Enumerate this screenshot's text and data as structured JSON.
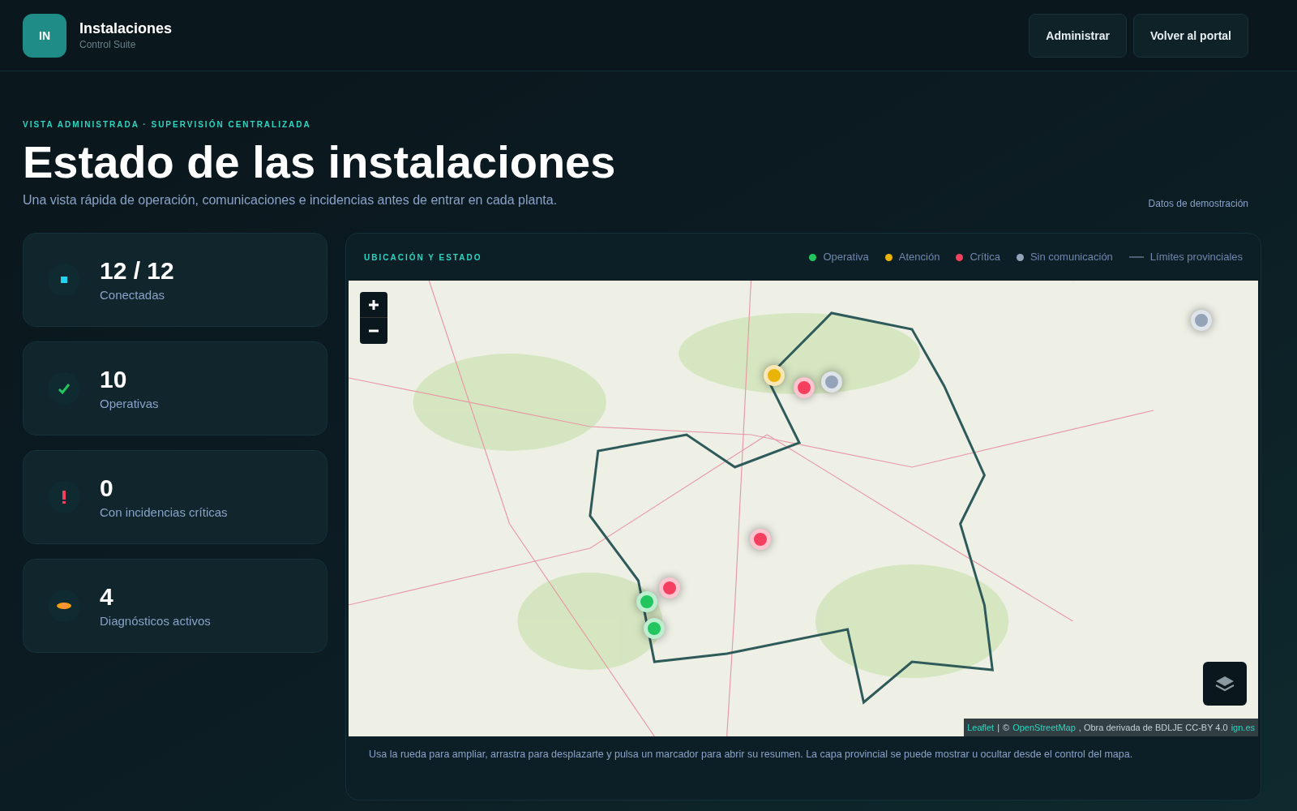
{
  "brand": {
    "logo": "IN",
    "title": "Instalaciones",
    "subtitle": "Control Suite"
  },
  "header_buttons": [
    "Administrar",
    "Volver al portal"
  ],
  "eyebrow": "VISTA ADMINISTRADA · SUPERVISIÓN CENTRALIZADA",
  "title": "Estado de las instalaciones",
  "subtitle": "Una vista rápida de operación, comunicaciones e incidencias antes de entrar en cada planta.",
  "demo_note": "Datos de demostración",
  "stats": [
    {
      "kind": "connected",
      "value": "12 / 12",
      "label": "Conectadas"
    },
    {
      "kind": "ok",
      "value": "10",
      "label": "Operativas"
    },
    {
      "kind": "critical",
      "value": "0",
      "label": "Con incidencias críticas"
    },
    {
      "kind": "diagnostic",
      "value": "4",
      "label": "Diagnósticos activos"
    }
  ],
  "map_panel": {
    "heading": "UBICACIÓN Y ESTADO",
    "legend": [
      {
        "kind": "dot",
        "label": "Operativa",
        "color": "#22c55e"
      },
      {
        "kind": "dot",
        "label": "Atención",
        "color": "#eab308"
      },
      {
        "kind": "dot",
        "label": "Crítica",
        "color": "#f43f5e"
      },
      {
        "kind": "dot",
        "label": "Sin comunicación",
        "color": "#94a3b8"
      },
      {
        "kind": "line",
        "label": "Límites provinciales"
      }
    ],
    "markers": [
      {
        "color": "#eab308"
      },
      {
        "color": "#f43f5e"
      },
      {
        "color": "#94a3b8"
      },
      {
        "color": "#94a3b8"
      },
      {
        "color": "#f43f5e"
      },
      {
        "color": "#f43f5e"
      },
      {
        "color": "#22c55e"
      },
      {
        "color": "#22c55e"
      }
    ],
    "attribution": [
      {
        "kind": "link",
        "text": "Leaflet"
      },
      {
        "kind": "sep",
        "text": "|"
      },
      {
        "kind": "text",
        "text": "©"
      },
      {
        "kind": "link",
        "text": "OpenStreetMap"
      },
      {
        "kind": "text",
        "text": ", Obra derivada de BDLJE CC-BY 4.0"
      },
      {
        "kind": "link",
        "text": "ign.es"
      }
    ],
    "help": "Usa la rueda para ampliar, arrastra para desplazarte y pulsa un marcador para abrir su resumen. La capa provincial se puede mostrar u ocultar desde el control del mapa."
  }
}
